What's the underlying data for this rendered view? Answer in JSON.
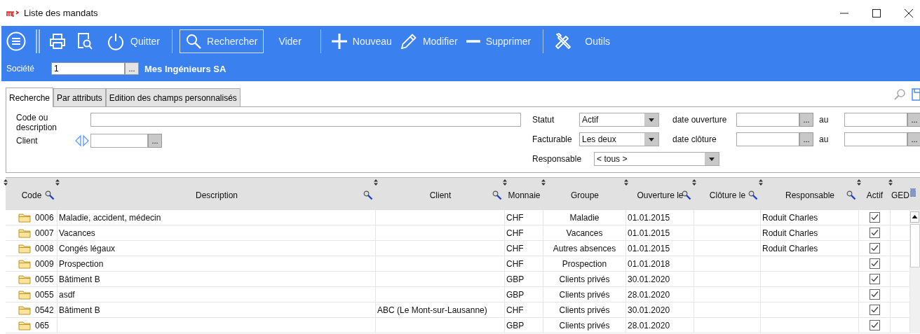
{
  "window": {
    "title": "Liste des mandats"
  },
  "toolbar": {
    "quit": "Quitter",
    "search": "Rechercher",
    "clear": "Vider",
    "new": "Nouveau",
    "edit": "Modifier",
    "delete": "Supprimer",
    "tools": "Outils"
  },
  "company": {
    "label": "Société",
    "value": "1",
    "button": "...",
    "name": "Mes Ingénieurs SA"
  },
  "tabs": [
    {
      "label": "Recherche",
      "selected": true
    },
    {
      "label": "Par attributs",
      "selected": false
    },
    {
      "label": "Edition des champs personnalisés",
      "selected": false
    }
  ],
  "filters": {
    "code_label": "Code ou description",
    "client_label": "Client",
    "client_button": "...",
    "status_label": "Statut",
    "status_value": "Actif",
    "billable_label": "Facturable",
    "billable_value": "Les deux",
    "manager_label": "Responsable",
    "manager_value": "< tous >",
    "open_label": "date ouverture",
    "close_label": "date clôture",
    "open_to_label": "au",
    "close_to_label": "au",
    "date_button": "..."
  },
  "table": {
    "columns": [
      {
        "label": "Code",
        "filter": true
      },
      {
        "label": "Description",
        "filter": true
      },
      {
        "label": "Client",
        "filter": true
      },
      {
        "label": "Monnaie",
        "filter": false
      },
      {
        "label": "Groupe",
        "filter": false
      },
      {
        "label": "Ouverture le",
        "filter": true
      },
      {
        "label": "Clôture le",
        "filter": true
      },
      {
        "label": "Responsable",
        "filter": true
      },
      {
        "label": "Actif",
        "filter": false
      },
      {
        "label": "GED",
        "filter": false
      }
    ],
    "rows": [
      {
        "code": "0006",
        "description": "Maladie, accident, médecin",
        "currency": "CHF",
        "group": "Maladie",
        "opened": "01.01.2015",
        "responsible": "Roduit Charles",
        "active": true
      },
      {
        "code": "0007",
        "description": "Vacances",
        "currency": "CHF",
        "group": "Vacances",
        "opened": "01.01.2015",
        "responsible": "Roduit Charles",
        "active": true
      },
      {
        "code": "0008",
        "description": "Congés légaux",
        "currency": "CHF",
        "group": "Autres absences",
        "opened": "01.01.2015",
        "responsible": "Roduit Charles",
        "active": true
      },
      {
        "code": "0009",
        "description": "Prospection",
        "currency": "CHF",
        "group": "Prospection",
        "opened": "01.01.2018",
        "active": true
      },
      {
        "code": "0055",
        "description": "Bâtiment B",
        "currency": "GBP",
        "group": "Clients privés",
        "opened": "30.01.2020",
        "active": true
      },
      {
        "code": "0055",
        "description": "asdf",
        "currency": "GBP",
        "group": "Clients privés",
        "opened": "28.01.2020",
        "active": true
      },
      {
        "code": "0542",
        "description": "Bâtiment B",
        "client": "ABC (Le Mont-sur-Lausanne)",
        "currency": "CHF",
        "group": "Clients privés",
        "opened": "30.01.2020",
        "active": true
      },
      {
        "code": "065",
        "currency": "GBP",
        "group": "Clients privés",
        "opened": "28.01.2020",
        "active": true
      }
    ]
  }
}
